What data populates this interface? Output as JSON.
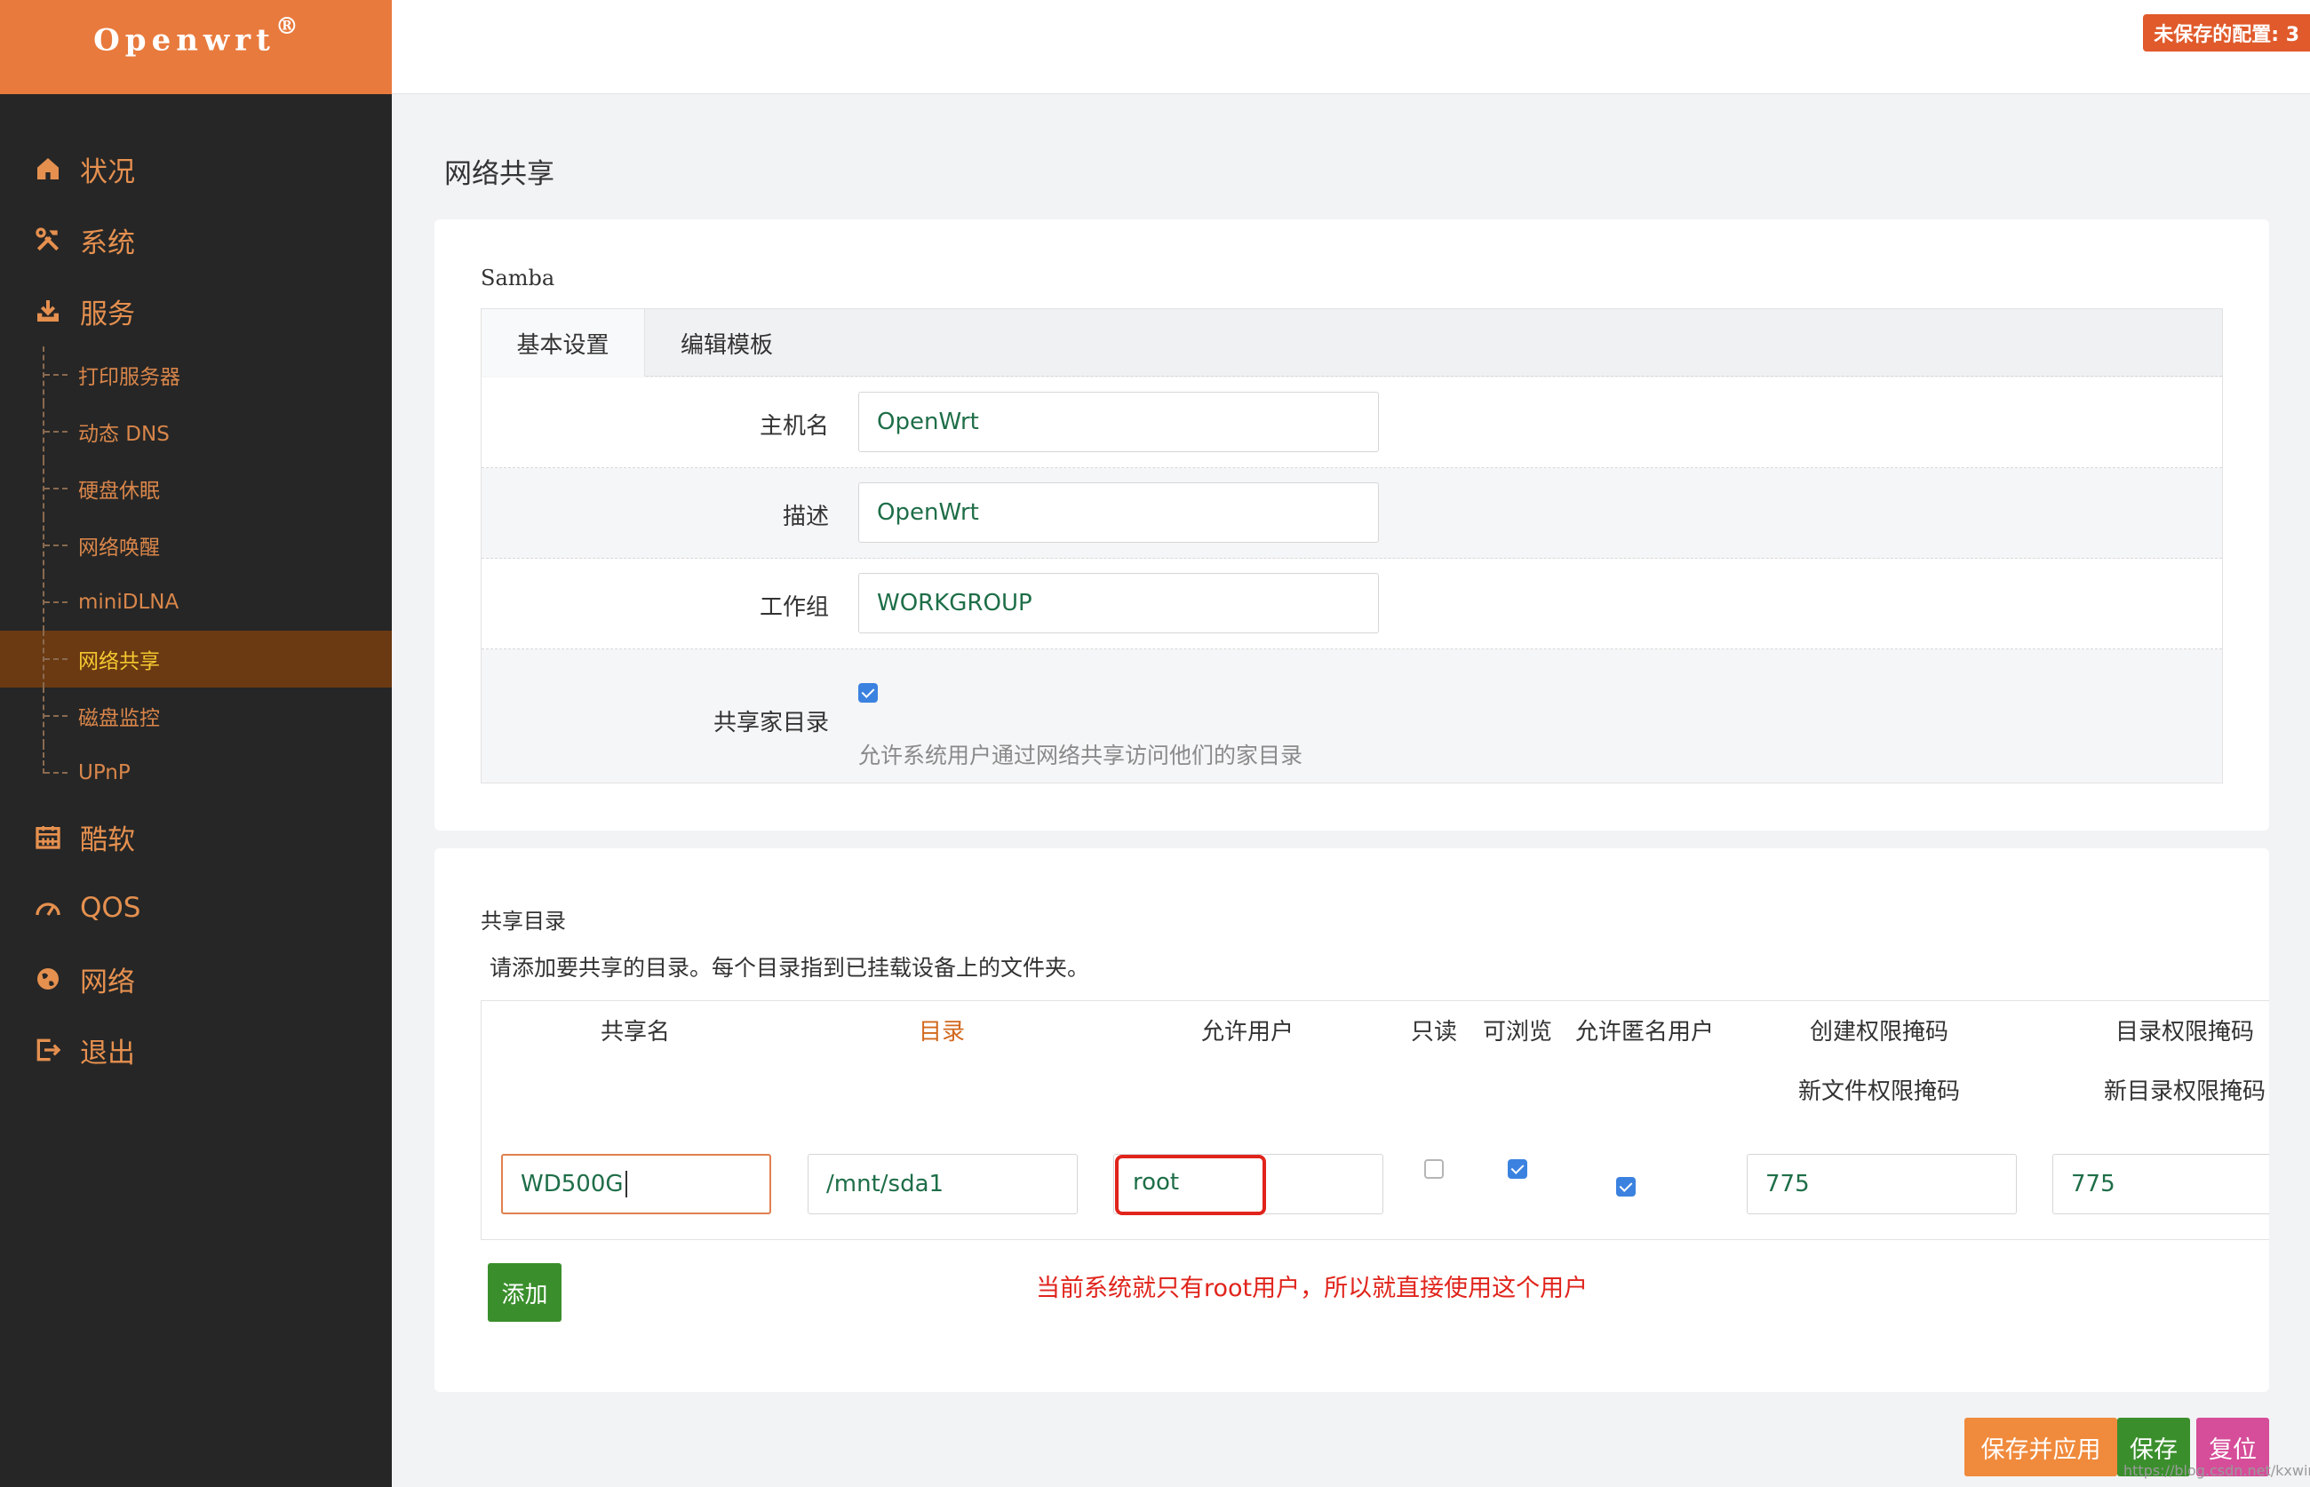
{
  "brand": {
    "name": "Openwrt",
    "mark": "®"
  },
  "topbar": {
    "unsaved_label": "未保存的配置: 3"
  },
  "sidebar": {
    "items": [
      {
        "label": "状况",
        "icon": "home-icon"
      },
      {
        "label": "系统",
        "icon": "tools-icon"
      },
      {
        "label": "服务",
        "icon": "download-icon"
      }
    ],
    "services_sub": [
      {
        "label": "打印服务器"
      },
      {
        "label": "动态 DNS"
      },
      {
        "label": "硬盘休眠"
      },
      {
        "label": "网络唤醒"
      },
      {
        "label": "miniDLNA"
      },
      {
        "label": "网络共享",
        "active": true
      },
      {
        "label": "磁盘监控"
      },
      {
        "label": "UPnP"
      }
    ],
    "items_after": [
      {
        "label": "酷软",
        "icon": "calendar-icon"
      },
      {
        "label": "QOS",
        "icon": "gauge-icon"
      },
      {
        "label": "网络",
        "icon": "globe-icon"
      },
      {
        "label": "退出",
        "icon": "logout-icon"
      }
    ]
  },
  "page": {
    "title": "网络共享"
  },
  "samba": {
    "section_label": "Samba",
    "tabs": [
      {
        "label": "基本设置"
      },
      {
        "label": "编辑模板"
      }
    ],
    "fields": {
      "hostname": {
        "label": "主机名",
        "value": "OpenWrt"
      },
      "description": {
        "label": "描述",
        "value": "OpenWrt"
      },
      "workgroup": {
        "label": "工作组",
        "value": "WORKGROUP"
      },
      "homes": {
        "label": "共享家目录",
        "checked": true,
        "hint": "允许系统用户通过网络共享访问他们的家目录"
      }
    }
  },
  "shares": {
    "section_label": "共享目录",
    "description": "请添加要共享的目录。每个目录指到已挂载设备上的文件夹。",
    "columns": {
      "name": "共享名",
      "path": "目录",
      "users": "允许用户",
      "read_only": "只读",
      "browseable": "可浏览",
      "guest_ok": "允许匿名用户",
      "create_mask": "创建权限掩码",
      "create_mask_sub": "新文件权限掩码",
      "dir_mask": "目录权限掩码",
      "dir_mask_sub": "新目录权限掩码"
    },
    "row": {
      "name": "WD500G",
      "path": "/mnt/sda1",
      "users": "root",
      "read_only": false,
      "browseable": true,
      "guest_ok": true,
      "create_mask": "775",
      "dir_mask": "775"
    },
    "add_label": "添加",
    "annotation": "当前系统就只有root用户，所以就直接使用这个用户"
  },
  "actions": {
    "apply_label": "保存并应用",
    "save_label": "保存",
    "reset_label": "复位"
  },
  "watermark": "https://blog.csdn.net/kxwinxp",
  "colors": {
    "accent": "#e87a3d",
    "sidebar_bg": "#262626",
    "save_green": "#3a8f2c",
    "reset_pink": "#d64d9a",
    "annotation_red": "#e0241c"
  }
}
